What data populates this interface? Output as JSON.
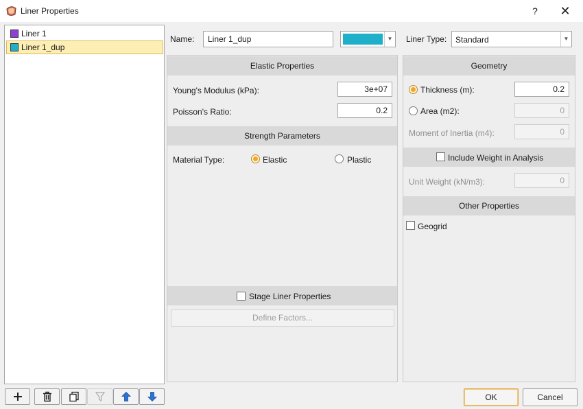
{
  "window": {
    "title": "Liner Properties",
    "help_label": "?",
    "close_label": "✕"
  },
  "liners": [
    {
      "name": "Liner 1",
      "color": "#8e3fd6",
      "selected": false
    },
    {
      "name": "Liner 1_dup",
      "color": "#1fb0c9",
      "selected": true
    }
  ],
  "toolbar": {
    "add": "plus-icon",
    "delete": "trash-icon",
    "copy": "copy-icon",
    "filter": "filter-icon",
    "up": "arrow-up-icon",
    "down": "arrow-down-icon"
  },
  "name_row": {
    "label": "Name:",
    "value": "Liner 1_dup",
    "color": "#1fb0c9"
  },
  "elastic": {
    "header": "Elastic Properties",
    "youngs_label": "Young's Modulus (kPa):",
    "youngs_value": "3e+07",
    "poisson_label": "Poisson's Ratio:",
    "poisson_value": "0.2"
  },
  "strength": {
    "header": "Strength Parameters",
    "material_label": "Material Type:",
    "options": [
      "Elastic",
      "Plastic"
    ],
    "selected": "Elastic"
  },
  "stage": {
    "label": "Stage Liner Properties",
    "checked": false,
    "define_label": "Define Factors..."
  },
  "liner_type": {
    "label": "Liner Type:",
    "value": "Standard"
  },
  "geometry": {
    "header": "Geometry",
    "thickness_label": "Thickness (m):",
    "thickness_value": "0.2",
    "area_label": "Area (m2):",
    "area_value": "0",
    "inertia_label": "Moment of Inertia (m4):",
    "inertia_value": "0"
  },
  "weight": {
    "include_label": "Include Weight in Analysis",
    "include_checked": false,
    "unit_label": "Unit Weight (kN/m3):",
    "unit_value": "0"
  },
  "other": {
    "header": "Other Properties",
    "geogrid_label": "Geogrid",
    "geogrid_checked": false
  },
  "footer": {
    "ok": "OK",
    "cancel": "Cancel"
  }
}
